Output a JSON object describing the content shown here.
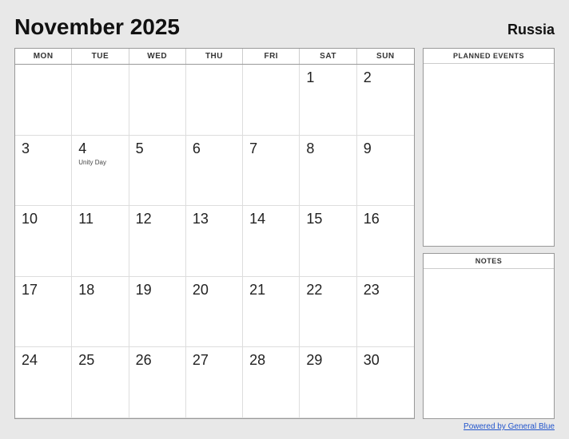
{
  "header": {
    "month_year": "November 2025",
    "country": "Russia"
  },
  "day_headers": [
    "MON",
    "TUE",
    "WED",
    "THU",
    "FRI",
    "SAT",
    "SUN"
  ],
  "weeks": [
    [
      {
        "date": "",
        "empty": true
      },
      {
        "date": "",
        "empty": true
      },
      {
        "date": "",
        "empty": true
      },
      {
        "date": "",
        "empty": true
      },
      {
        "date": "",
        "empty": true
      },
      {
        "date": "1",
        "event": ""
      },
      {
        "date": "2",
        "event": ""
      }
    ],
    [
      {
        "date": "3",
        "event": ""
      },
      {
        "date": "4",
        "event": "Unity Day"
      },
      {
        "date": "5",
        "event": ""
      },
      {
        "date": "6",
        "event": ""
      },
      {
        "date": "7",
        "event": ""
      },
      {
        "date": "8",
        "event": ""
      },
      {
        "date": "9",
        "event": ""
      }
    ],
    [
      {
        "date": "10",
        "event": ""
      },
      {
        "date": "11",
        "event": ""
      },
      {
        "date": "12",
        "event": ""
      },
      {
        "date": "13",
        "event": ""
      },
      {
        "date": "14",
        "event": ""
      },
      {
        "date": "15",
        "event": ""
      },
      {
        "date": "16",
        "event": ""
      }
    ],
    [
      {
        "date": "17",
        "event": ""
      },
      {
        "date": "18",
        "event": ""
      },
      {
        "date": "19",
        "event": ""
      },
      {
        "date": "20",
        "event": ""
      },
      {
        "date": "21",
        "event": ""
      },
      {
        "date": "22",
        "event": ""
      },
      {
        "date": "23",
        "event": ""
      }
    ],
    [
      {
        "date": "24",
        "event": ""
      },
      {
        "date": "25",
        "event": ""
      },
      {
        "date": "26",
        "event": ""
      },
      {
        "date": "27",
        "event": ""
      },
      {
        "date": "28",
        "event": ""
      },
      {
        "date": "29",
        "event": ""
      },
      {
        "date": "30",
        "event": ""
      }
    ]
  ],
  "sidebar": {
    "planned_events_label": "PLANNED EVENTS",
    "notes_label": "NOTES"
  },
  "footer": {
    "link_text": "Powered by General Blue"
  }
}
